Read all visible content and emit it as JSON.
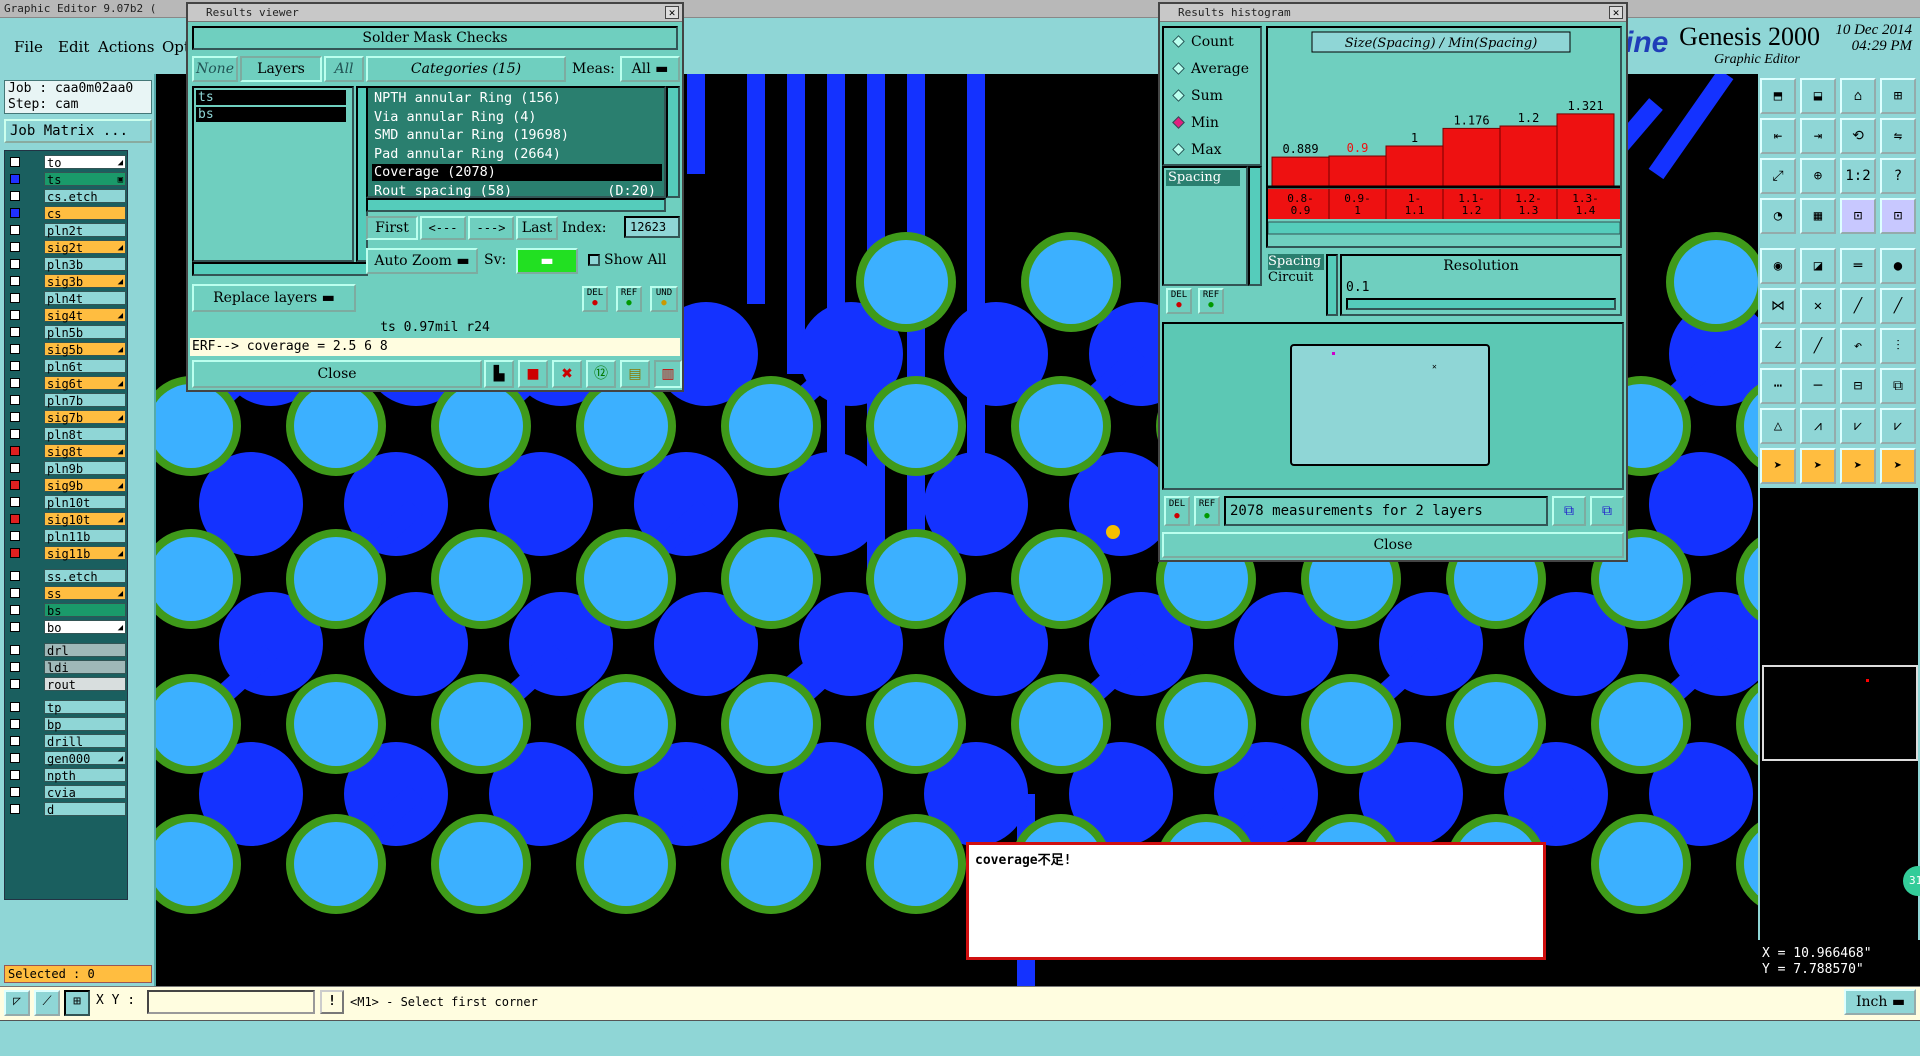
{
  "window": {
    "title": "Graphic Editor 9.07b2  ("
  },
  "menu": {
    "file": "File",
    "edit": "Edit",
    "actions": "Actions",
    "options": "Opt"
  },
  "brand": {
    "line": "ine",
    "product": "Genesis 2000",
    "subtitle": "Graphic Editor",
    "date": "10 Dec 2014",
    "time": "04:29 PM"
  },
  "job": {
    "job_line": "Job : caa0m02aa0",
    "step_line": "Step: cam",
    "matrix_button": "Job Matrix ..."
  },
  "layers": [
    {
      "name": "to",
      "color": "#ffffff",
      "mark": "◢",
      "chk": ""
    },
    {
      "name": "ts",
      "color": "#1a9a6a",
      "mark": "▣",
      "chk": "sel"
    },
    {
      "name": "cs.etch",
      "color": "#8fd6d6",
      "mark": "",
      "chk": ""
    },
    {
      "name": "cs",
      "color": "#ffbd40",
      "mark": "",
      "chk": "sel"
    },
    {
      "name": "pln2t",
      "color": "#8fd6d6",
      "mark": "",
      "chk": ""
    },
    {
      "name": "sig2t",
      "color": "#ffbd40",
      "mark": "◢",
      "chk": ""
    },
    {
      "name": "pln3b",
      "color": "#8fd6d6",
      "mark": "",
      "chk": ""
    },
    {
      "name": "sig3b",
      "color": "#ffbd40",
      "mark": "◢",
      "chk": ""
    },
    {
      "name": "pln4t",
      "color": "#8fd6d6",
      "mark": "",
      "chk": ""
    },
    {
      "name": "sig4t",
      "color": "#ffbd40",
      "mark": "◢",
      "chk": ""
    },
    {
      "name": "pln5b",
      "color": "#8fd6d6",
      "mark": "",
      "chk": ""
    },
    {
      "name": "sig5b",
      "color": "#ffbd40",
      "mark": "◢",
      "chk": ""
    },
    {
      "name": "pln6t",
      "color": "#8fd6d6",
      "mark": "",
      "chk": ""
    },
    {
      "name": "sig6t",
      "color": "#ffbd40",
      "mark": "◢",
      "chk": ""
    },
    {
      "name": "pln7b",
      "color": "#8fd6d6",
      "mark": "",
      "chk": ""
    },
    {
      "name": "sig7b",
      "color": "#ffbd40",
      "mark": "◢",
      "chk": ""
    },
    {
      "name": "pln8t",
      "color": "#8fd6d6",
      "mark": "",
      "chk": ""
    },
    {
      "name": "sig8t",
      "color": "#ffbd40",
      "mark": "◢",
      "chk": "red"
    },
    {
      "name": "pln9b",
      "color": "#8fd6d6",
      "mark": "",
      "chk": ""
    },
    {
      "name": "sig9b",
      "color": "#ffbd40",
      "mark": "◢",
      "chk": "red"
    },
    {
      "name": "pln10t",
      "color": "#8fd6d6",
      "mark": "",
      "chk": ""
    },
    {
      "name": "sig10t",
      "color": "#ffbd40",
      "mark": "◢",
      "chk": "red"
    },
    {
      "name": "pln11b",
      "color": "#8fd6d6",
      "mark": "",
      "chk": ""
    },
    {
      "name": "sig11b",
      "color": "#ffbd40",
      "mark": "◢",
      "chk": "red"
    },
    {
      "name": "ss.etch",
      "color": "#8fd6d6",
      "mark": "",
      "chk": ""
    },
    {
      "name": "ss",
      "color": "#ffbd40",
      "mark": "◢",
      "chk": ""
    },
    {
      "name": "bs",
      "color": "#1a9a6a",
      "mark": "",
      "chk": ""
    },
    {
      "name": "bo",
      "color": "#ffffff",
      "mark": "◢",
      "chk": ""
    },
    {
      "name": "drl",
      "color": "#9fb8b8",
      "mark": "",
      "chk": ""
    },
    {
      "name": "ldi",
      "color": "#9fb8b8",
      "mark": "",
      "chk": ""
    },
    {
      "name": "rout",
      "color": "#d8dede",
      "mark": "",
      "chk": ""
    },
    {
      "name": "tp",
      "color": "#8fd6d6",
      "mark": "",
      "chk": ""
    },
    {
      "name": "bp",
      "color": "#8fd6d6",
      "mark": "",
      "chk": ""
    },
    {
      "name": "drill",
      "color": "#8fd6d6",
      "mark": "",
      "chk": ""
    },
    {
      "name": "gen000",
      "color": "#8fd6d6",
      "mark": "◢",
      "chk": ""
    },
    {
      "name": "npth",
      "color": "#8fd6d6",
      "mark": "",
      "chk": ""
    },
    {
      "name": "cvia",
      "color": "#8fd6d6",
      "mark": "",
      "chk": ""
    },
    {
      "name": "d",
      "color": "#8fd6d6",
      "mark": "",
      "chk": ""
    }
  ],
  "selected": "Selected : 0",
  "results_viewer": {
    "title": "Results viewer",
    "header": "Solder Mask Checks",
    "none_btn": "None",
    "layers_btn": "Layers",
    "all_btn": "All",
    "categories_btn": "Categories (15)",
    "meas_label": "Meas:",
    "meas_value": "All",
    "layer_items": [
      "ts",
      "bs"
    ],
    "categories": [
      {
        "label": "NPTH annular Ring (156)",
        "sel": false
      },
      {
        "label": "Via annular Ring (4)",
        "sel": false
      },
      {
        "label": "SMD annular Ring (19698)",
        "sel": false
      },
      {
        "label": "Pad annular Ring (2664)",
        "sel": false
      },
      {
        "label": "Coverage (2078)",
        "sel": true
      },
      {
        "label": "Rout spacing (58)",
        "sel": false,
        "extra": "(D:20)"
      }
    ],
    "first_btn": "First",
    "prev_btn": "<---",
    "next_btn": "--->",
    "last_btn": "Last",
    "index_label": "Index:",
    "index_value": "12623",
    "zoom_btn": "Auto Zoom",
    "sv_label": "Sv:",
    "show_all": "Show All",
    "replace_btn": "Replace layers",
    "del": "DEL",
    "ref": "REF",
    "und": "UND",
    "info_line": "ts 0.97mil  r24",
    "erf_line": "ERF--> coverage = 2.5 6 8",
    "close_btn": "Close"
  },
  "histogram": {
    "title": "Results histogram",
    "chart_title": "Size(Spacing) / Min(Spacing)",
    "options": [
      {
        "label": "Count",
        "on": false
      },
      {
        "label": "Average",
        "on": false
      },
      {
        "label": "Sum",
        "on": false
      },
      {
        "label": "Min",
        "on": true
      },
      {
        "label": "Max",
        "on": false
      }
    ],
    "list_item": "Spacing",
    "spacing_btn": "Spacing",
    "circuit_label": "Circuit",
    "resolution_label": "Resolution",
    "resolution_value": "0.1",
    "del": "DEL",
    "ref": "REF",
    "summary": "2078 measurements for 2 layers",
    "close_btn": "Close"
  },
  "chart_data": {
    "type": "bar",
    "title": "Size(Spacing) / Min(Spacing)",
    "categories": [
      "0.8-0.9",
      "0.9-1",
      "1-1.1",
      "1.1-1.2",
      "1.2-1.3",
      "1.3-1.4"
    ],
    "category_lines": [
      [
        "0.8-",
        "0.9"
      ],
      [
        "0.9-",
        "1"
      ],
      [
        "1-",
        "1.1"
      ],
      [
        "1.1-",
        "1.2"
      ],
      [
        "1.2-",
        "1.3"
      ],
      [
        "1.3-",
        "1.4"
      ]
    ],
    "values": [
      0.889,
      0.9,
      1,
      1.176,
      1.2,
      1.321
    ],
    "value_labels": [
      "0.889",
      "0.9",
      "1",
      "1.176",
      "1.2",
      "1.321"
    ],
    "ylim": [
      0.6,
      1.4
    ],
    "highlight_index": 1,
    "bar_color": "#ee1111"
  },
  "message": {
    "text": "coverage不足!"
  },
  "bottom": {
    "xy_label": "X Y :",
    "hint": "<M1> - Select first corner",
    "unit": "Inch"
  },
  "coords": {
    "x": "X = 10.966468\"",
    "y": "Y = 7.788570\""
  },
  "badge": "31"
}
